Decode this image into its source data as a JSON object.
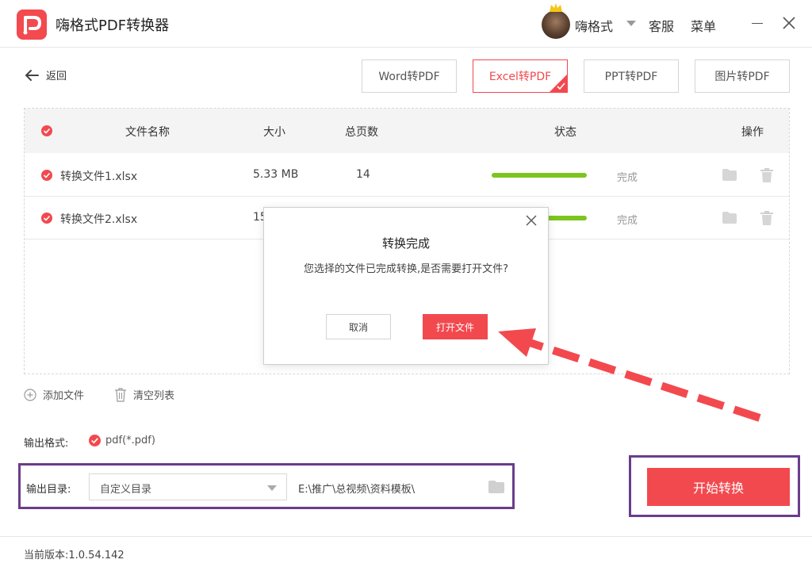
{
  "app": {
    "title": "嗨格式PDF转换器",
    "username": "嗨格式",
    "service": "客服",
    "menu": "菜单"
  },
  "nav": {
    "back": "返回",
    "tabs": [
      {
        "label": "Word转PDF",
        "active": false
      },
      {
        "label": "Excel转PDF",
        "active": true
      },
      {
        "label": "PPT转PDF",
        "active": false
      },
      {
        "label": "图片转PDF",
        "active": false
      }
    ]
  },
  "table": {
    "headers": {
      "name": "文件名称",
      "size": "大小",
      "pages": "总页数",
      "status": "状态",
      "actions": "操作"
    },
    "rows": [
      {
        "name": "转换文件1.xlsx",
        "size": "5.33 MB",
        "pages": "14",
        "progress": 1.0,
        "status": "完成"
      },
      {
        "name": "转换文件2.xlsx",
        "size": "15",
        "pages": "",
        "progress": 1.0,
        "status": "完成"
      }
    ]
  },
  "actions": {
    "add_file": "添加文件",
    "clear_list": "清空列表"
  },
  "output": {
    "format_label": "输出格式:",
    "format_value": "pdf(*.pdf)",
    "dir_label": "输出目录:",
    "dir_select": "自定义目录",
    "dir_path": "E:\\推广\\总视频\\资料模板\\"
  },
  "start_button": "开始转换",
  "footer": {
    "version": "当前版本:1.0.54.142"
  },
  "dialog": {
    "title": "转换完成",
    "message": "您选择的文件已完成转换,是否需要打开文件?",
    "cancel": "取消",
    "open": "打开文件"
  },
  "colors": {
    "accent": "#f2494f",
    "progress": "#7cc520",
    "highlight_border": "#6a3d8c"
  }
}
